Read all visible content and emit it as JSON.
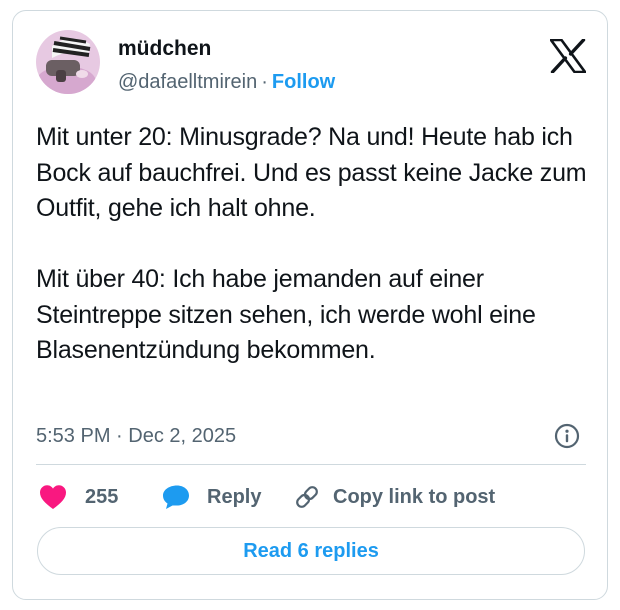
{
  "author": {
    "display_name": "müdchen",
    "handle": "@dafaelltmirein",
    "separator": "·",
    "follow_label": "Follow"
  },
  "logo": {
    "icon": "x-logo-icon"
  },
  "tweet": {
    "paragraphs": [
      "Mit unter 20: Minusgrade? Na und! Heute hab ich Bock auf bauchfrei. Und es passt keine Jacke zum Outfit, gehe ich halt ohne.",
      "Mit über 40: Ich habe jemanden auf einer Steintreppe sitzen sehen, ich werde wohl eine Blasenentzündung bekommen."
    ],
    "timestamp": "5:53 PM · Dec 2, 2025"
  },
  "actions": {
    "like": {
      "icon": "heart-icon",
      "count": "255"
    },
    "reply": {
      "icon": "speech-bubble-icon",
      "label": "Reply"
    },
    "copy_link": {
      "icon": "link-icon",
      "label": "Copy link to post"
    }
  },
  "read_replies_label": "Read 6 replies",
  "colors": {
    "accent": "#1d9bf0",
    "like": "#f91880",
    "secondary_text": "#536471",
    "border": "#cfd9de",
    "text": "#0f1419"
  }
}
